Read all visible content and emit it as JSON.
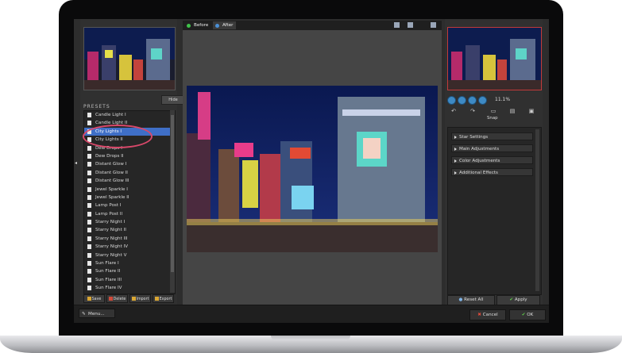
{
  "tabs": {
    "before": "Before",
    "after": "After"
  },
  "left_panel": {
    "hide_label": "Hide",
    "presets_heading": "PRESETS",
    "presets": [
      {
        "label": "Candle Light I"
      },
      {
        "label": "Candle Light II"
      },
      {
        "label": "City Lights I",
        "selected": true
      },
      {
        "label": "City Lights II"
      },
      {
        "label": "Dew Drops I"
      },
      {
        "label": "Dew Drops II"
      },
      {
        "label": "Distant Glow I"
      },
      {
        "label": "Distant Glow II"
      },
      {
        "label": "Distant Glow III"
      },
      {
        "label": "Jewel Sparkle I"
      },
      {
        "label": "Jewel Sparkle II"
      },
      {
        "label": "Lamp Post I"
      },
      {
        "label": "Lamp Post II"
      },
      {
        "label": "Starry Night I"
      },
      {
        "label": "Starry Night II"
      },
      {
        "label": "Starry Night III"
      },
      {
        "label": "Starry Night IV"
      },
      {
        "label": "Starry Night V"
      },
      {
        "label": "Sun Flare I"
      },
      {
        "label": "Sun Flare II"
      },
      {
        "label": "Sun Flare III"
      },
      {
        "label": "Sun Flare IV"
      }
    ],
    "buttons": {
      "save": "Save",
      "delete": "Delete",
      "import": "Import",
      "export": "Export"
    }
  },
  "right_panel": {
    "zoom_level": "11.1%",
    "snap_label": "Snap",
    "adjustments": [
      "Star Settings",
      "Main Adjustments",
      "Color Adjustments",
      "Additional Effects"
    ],
    "reset_all": "Reset All",
    "apply": "Apply"
  },
  "footer": {
    "menu": "Menu...",
    "cancel": "Cancel",
    "ok": "OK"
  },
  "colors": {
    "selection": "#3f6fc7",
    "highlight_ellipse": "#d9486a",
    "preview_border": "#c13a3a"
  }
}
